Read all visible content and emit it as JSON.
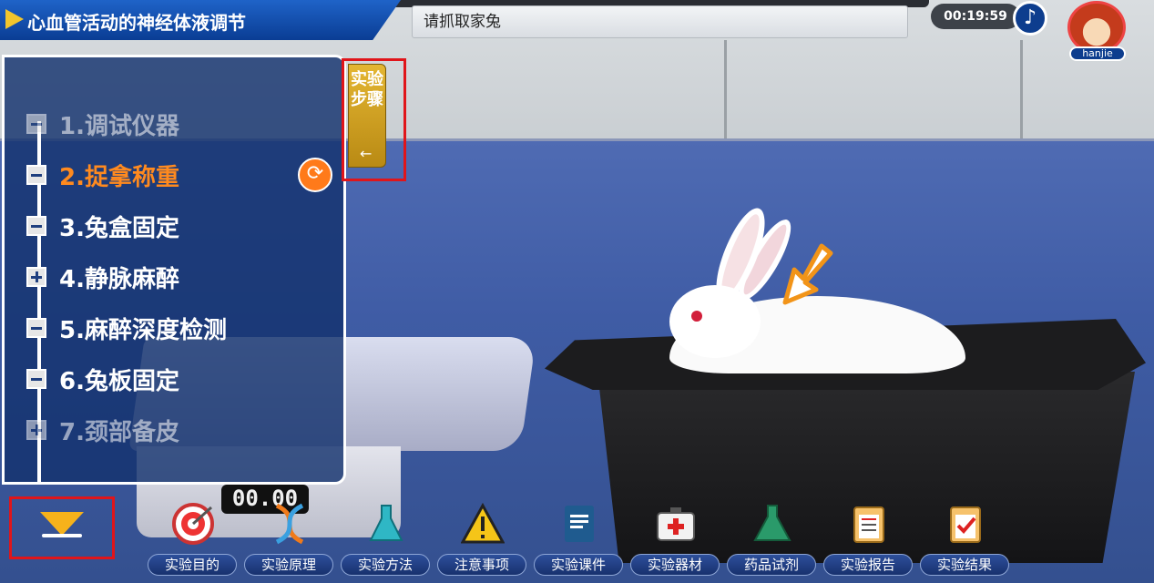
{
  "header": {
    "title": "心血管活动的神经体液调节",
    "instruction": "请抓取家兔",
    "timer": "00:19:59",
    "music_icon": "music-note-icon",
    "username": "hanjie"
  },
  "steps_panel": {
    "tab_label": "实验步骤",
    "tab_arrow": "←",
    "steps": [
      {
        "label": "1.调试仪器",
        "state": "done"
      },
      {
        "label": "2.捉拿称重",
        "state": "active"
      },
      {
        "label": "3.兔盒固定",
        "state": "normal"
      },
      {
        "label": "4.静脉麻醉",
        "state": "expandable"
      },
      {
        "label": "5.麻醉深度检测",
        "state": "normal"
      },
      {
        "label": "6.兔板固定",
        "state": "normal"
      },
      {
        "label": "7.颈部备皮",
        "state": "expandable"
      }
    ],
    "refresh_icon": "refresh-icon"
  },
  "scale": {
    "display": "00.00"
  },
  "toolbar": {
    "items": [
      {
        "label": "实验目的",
        "icon": "target-icon"
      },
      {
        "label": "实验原理",
        "icon": "dna-icon"
      },
      {
        "label": "实验方法",
        "icon": "flask-icon"
      },
      {
        "label": "注意事项",
        "icon": "warning-icon"
      },
      {
        "label": "实验课件",
        "icon": "book-icon"
      },
      {
        "label": "实验器材",
        "icon": "first-aid-kit-icon"
      },
      {
        "label": "药品试剂",
        "icon": "reagent-flask-icon"
      },
      {
        "label": "实验报告",
        "icon": "report-clipboard-icon"
      },
      {
        "label": "实验结果",
        "icon": "result-clipboard-icon"
      }
    ]
  },
  "colors": {
    "accent": "#ff8a1f",
    "header_blue": "#0a3d94",
    "highlight_red": "#e0151a"
  }
}
